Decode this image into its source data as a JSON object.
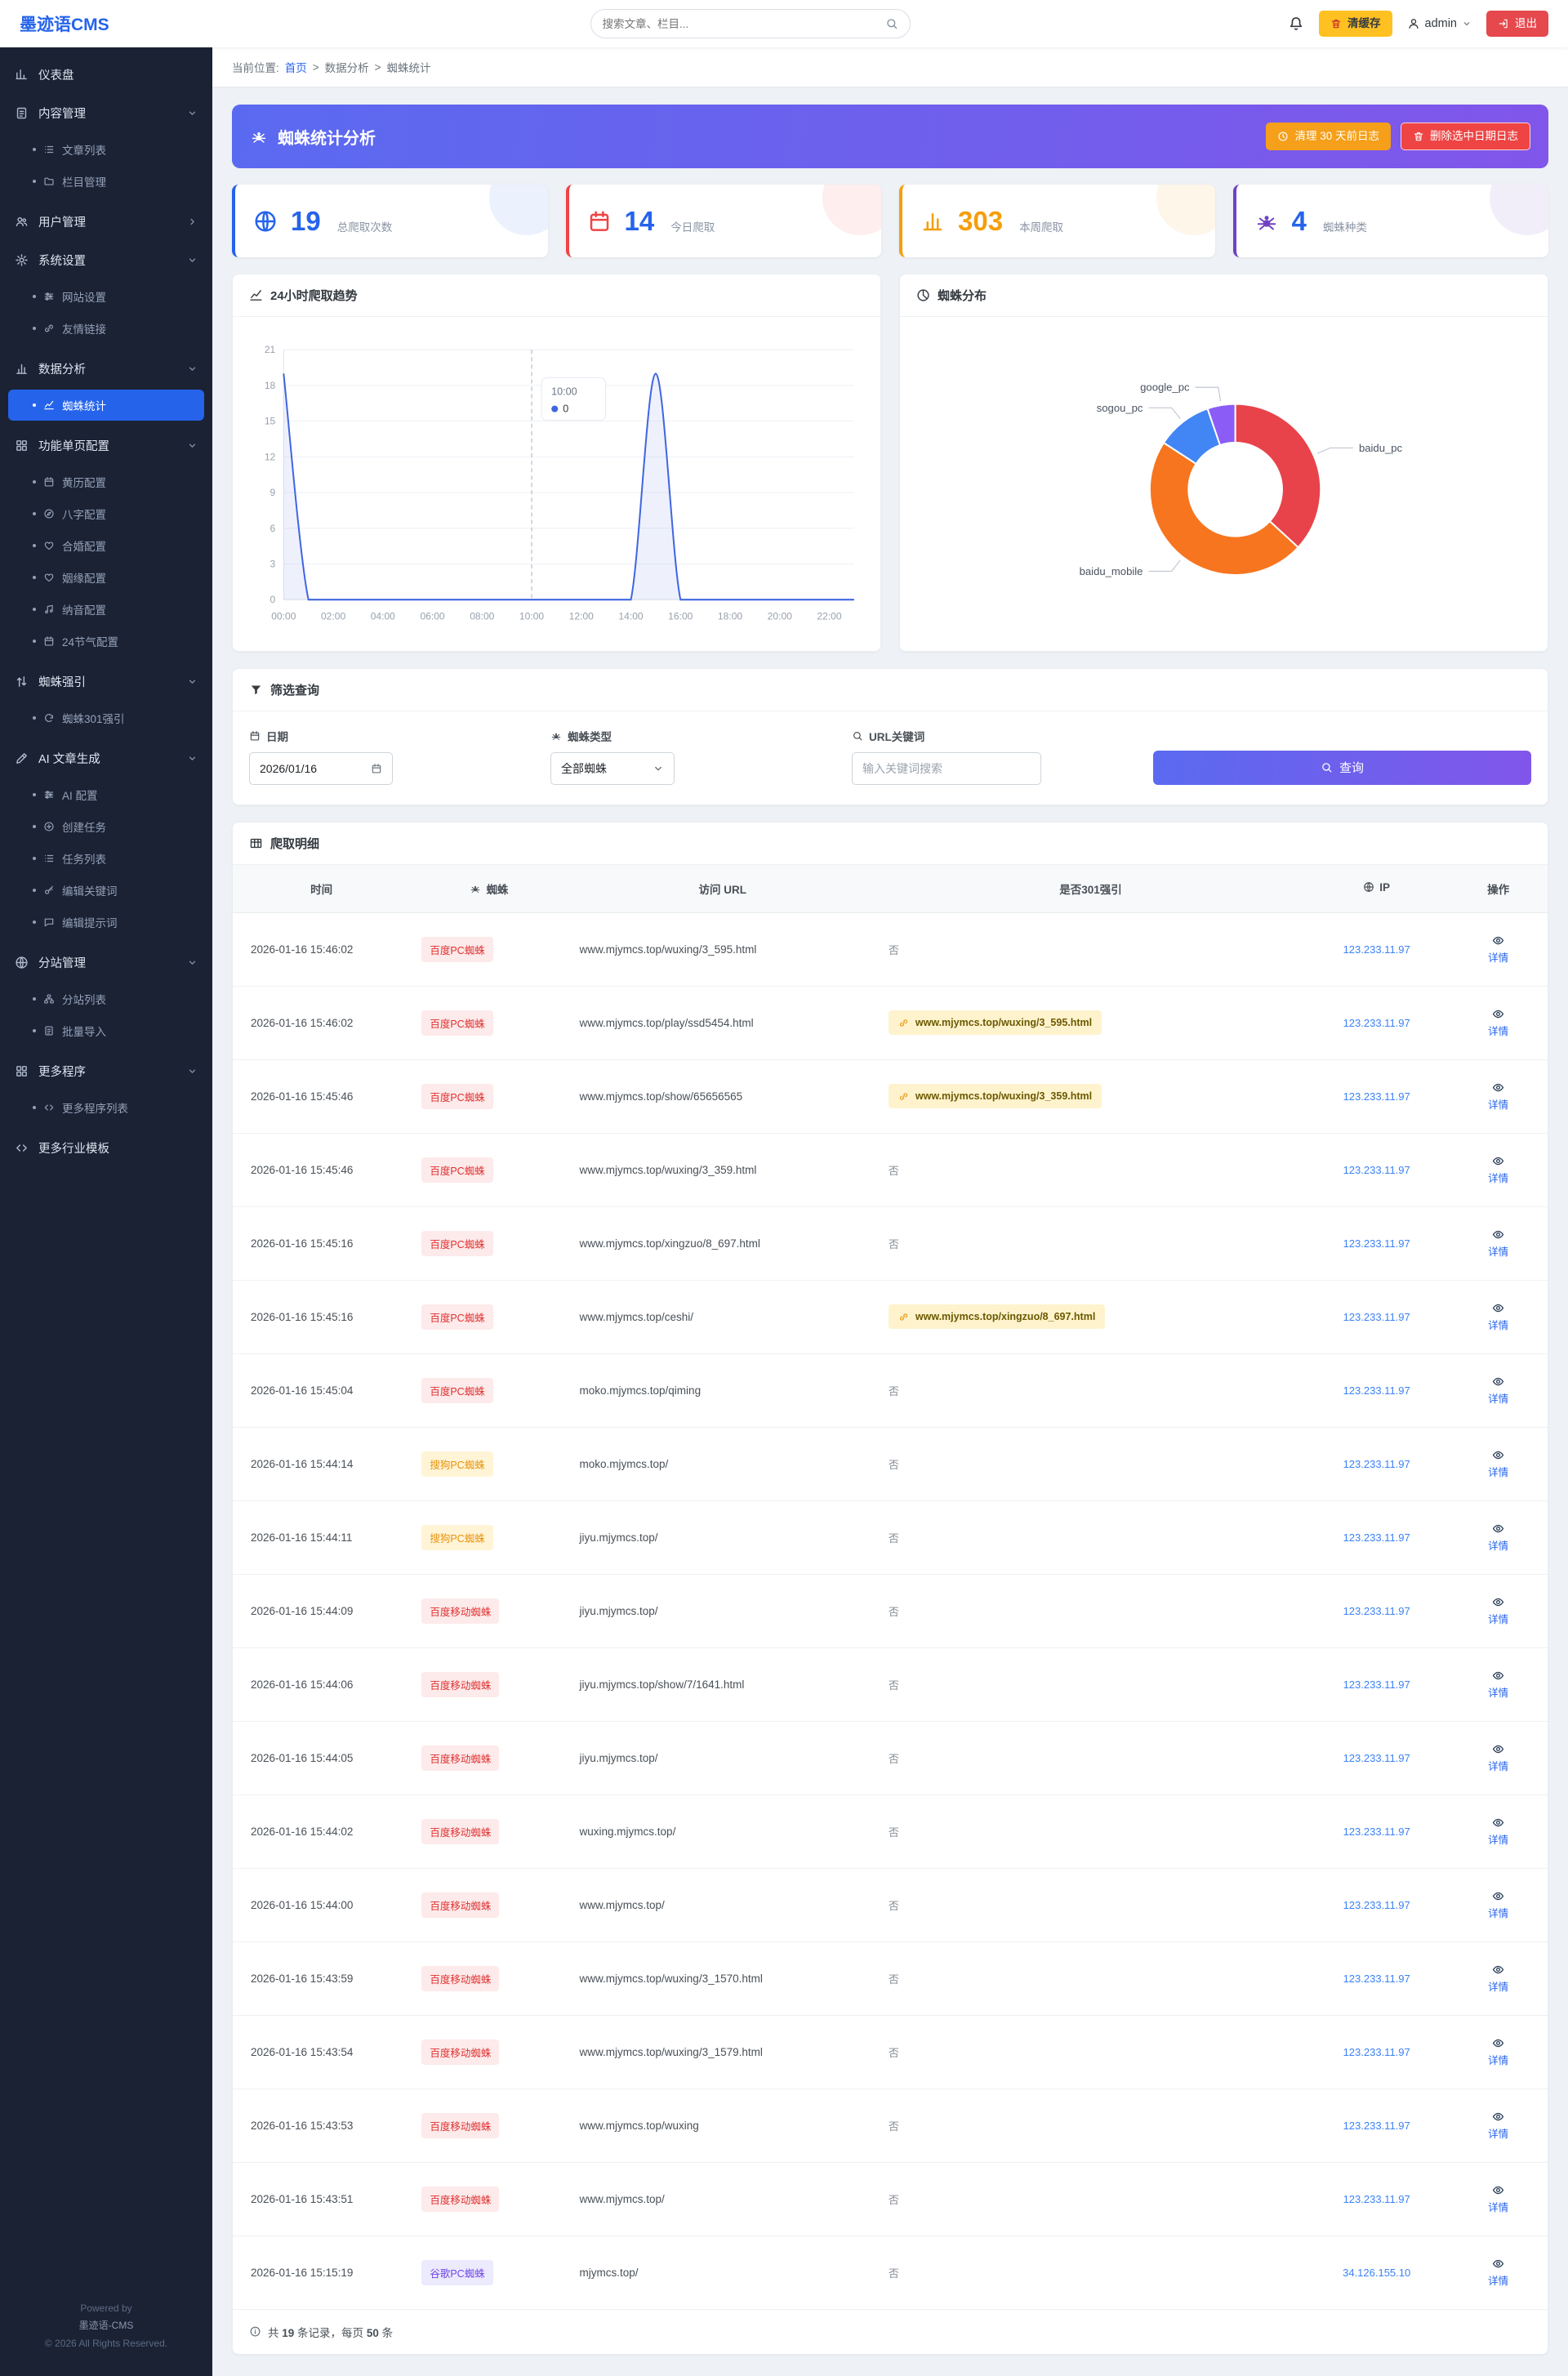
{
  "topbar": {
    "logo": "墨迹语CMS",
    "search_placeholder": "搜索文章、栏目...",
    "clear_cache_label": "清缓存",
    "username": "admin",
    "logout_label": "退出"
  },
  "breadcrumb": {
    "prefix": "当前位置:",
    "home": "首页",
    "sep": ">",
    "section": "数据分析",
    "current": "蜘蛛统计"
  },
  "page_header": {
    "title": "蜘蛛统计分析",
    "btn_clean": "清理 30 天前日志",
    "btn_delete": "删除选中日期日志"
  },
  "stats": {
    "cards": [
      {
        "value": "19",
        "label": "总爬取次数",
        "accent": "#2563eb",
        "number_color": "#2563eb",
        "icon": "globe"
      },
      {
        "value": "14",
        "label": "今日爬取",
        "accent": "#ef4444",
        "number_color": "#2563eb",
        "icon": "calendar"
      },
      {
        "value": "303",
        "label": "本周爬取",
        "accent": "#f59e0b",
        "number_color": "#f59e0b",
        "icon": "chart"
      },
      {
        "value": "4",
        "label": "蜘蛛种类",
        "accent": "#6f42c1",
        "number_color": "#2563eb",
        "icon": "spider"
      }
    ]
  },
  "chart_data": [
    {
      "type": "line",
      "title": "24小时爬取趋势",
      "x": [
        "00:00",
        "01:00",
        "02:00",
        "03:00",
        "04:00",
        "05:00",
        "06:00",
        "07:00",
        "08:00",
        "09:00",
        "10:00",
        "11:00",
        "12:00",
        "13:00",
        "14:00",
        "15:00",
        "16:00",
        "17:00",
        "18:00",
        "19:00",
        "20:00",
        "21:00",
        "22:00",
        "23:00"
      ],
      "values": [
        19,
        0,
        0,
        0,
        0,
        0,
        0,
        0,
        0,
        0,
        0,
        0,
        0,
        0,
        0,
        19,
        0,
        0,
        0,
        0,
        0,
        0,
        0,
        0
      ],
      "ylim": [
        0,
        21
      ],
      "yticks": [
        0,
        3,
        6,
        9,
        12,
        15,
        18,
        21
      ],
      "line_color": "#4066e0",
      "grid": true,
      "legend": false,
      "tooltip": {
        "x": "10:00",
        "value": 0
      }
    },
    {
      "type": "pie",
      "title": "蜘蛛分布",
      "labels": [
        "baidu_pc",
        "baidu_mobile",
        "sogou_pc",
        "google_pc"
      ],
      "values": [
        7,
        9,
        2,
        1
      ],
      "colors": [
        "#e8434a",
        "#f7751f",
        "#4285f4",
        "#8b5cf6"
      ],
      "donut": true,
      "legend_position": "outside-labels"
    }
  ],
  "filter": {
    "title": "筛选查询",
    "date_label": "日期",
    "date_value": "2026/01/16",
    "type_label": "蜘蛛类型",
    "type_value": "全部蜘蛛",
    "keyword_label": "URL关键词",
    "keyword_placeholder": "输入关键词搜索",
    "search_label": "查询"
  },
  "table": {
    "title": "爬取明细",
    "columns": [
      {
        "key": "time",
        "label": "时间"
      },
      {
        "key": "spider",
        "label": "蜘蛛",
        "icon": "spider"
      },
      {
        "key": "url",
        "label": "访问 URL"
      },
      {
        "key": "redirect",
        "label": "是否301强引"
      },
      {
        "key": "ip",
        "label": "IP",
        "icon": "globe"
      },
      {
        "key": "action",
        "label": "操作"
      }
    ],
    "no_redirect_text": "否",
    "action_label": "详情",
    "rows": [
      {
        "time": "2026-01-16 15:46:02",
        "spider": "百度PC蜘蛛",
        "spider_type": "baidu_pc",
        "url": "www.mjymcs.top/wuxing/3_595.html",
        "redirect": "",
        "ip": "123.233.11.97"
      },
      {
        "time": "2026-01-16 15:46:02",
        "spider": "百度PC蜘蛛",
        "spider_type": "baidu_pc",
        "url": "www.mjymcs.top/play/ssd5454.html",
        "redirect": "www.mjymcs.top/wuxing/3_595.html",
        "ip": "123.233.11.97"
      },
      {
        "time": "2026-01-16 15:45:46",
        "spider": "百度PC蜘蛛",
        "spider_type": "baidu_pc",
        "url": "www.mjymcs.top/show/65656565",
        "redirect": "www.mjymcs.top/wuxing/3_359.html",
        "ip": "123.233.11.97"
      },
      {
        "time": "2026-01-16 15:45:46",
        "spider": "百度PC蜘蛛",
        "spider_type": "baidu_pc",
        "url": "www.mjymcs.top/wuxing/3_359.html",
        "redirect": "",
        "ip": "123.233.11.97"
      },
      {
        "time": "2026-01-16 15:45:16",
        "spider": "百度PC蜘蛛",
        "spider_type": "baidu_pc",
        "url": "www.mjymcs.top/xingzuo/8_697.html",
        "redirect": "",
        "ip": "123.233.11.97"
      },
      {
        "time": "2026-01-16 15:45:16",
        "spider": "百度PC蜘蛛",
        "spider_type": "baidu_pc",
        "url": "www.mjymcs.top/ceshi/",
        "redirect": "www.mjymcs.top/xingzuo/8_697.html",
        "ip": "123.233.11.97"
      },
      {
        "time": "2026-01-16 15:45:04",
        "spider": "百度PC蜘蛛",
        "spider_type": "baidu_pc",
        "url": "moko.mjymcs.top/qiming",
        "redirect": "",
        "ip": "123.233.11.97"
      },
      {
        "time": "2026-01-16 15:44:14",
        "spider": "搜狗PC蜘蛛",
        "spider_type": "sogou_pc",
        "url": "moko.mjymcs.top/",
        "redirect": "",
        "ip": "123.233.11.97"
      },
      {
        "time": "2026-01-16 15:44:11",
        "spider": "搜狗PC蜘蛛",
        "spider_type": "sogou_pc",
        "url": "jiyu.mjymcs.top/",
        "redirect": "",
        "ip": "123.233.11.97"
      },
      {
        "time": "2026-01-16 15:44:09",
        "spider": "百度移动蜘蛛",
        "spider_type": "baidu_mobile",
        "url": "jiyu.mjymcs.top/",
        "redirect": "",
        "ip": "123.233.11.97"
      },
      {
        "time": "2026-01-16 15:44:06",
        "spider": "百度移动蜘蛛",
        "spider_type": "baidu_mobile",
        "url": "jiyu.mjymcs.top/show/7/1641.html",
        "redirect": "",
        "ip": "123.233.11.97"
      },
      {
        "time": "2026-01-16 15:44:05",
        "spider": "百度移动蜘蛛",
        "spider_type": "baidu_mobile",
        "url": "jiyu.mjymcs.top/",
        "redirect": "",
        "ip": "123.233.11.97"
      },
      {
        "time": "2026-01-16 15:44:02",
        "spider": "百度移动蜘蛛",
        "spider_type": "baidu_mobile",
        "url": "wuxing.mjymcs.top/",
        "redirect": "",
        "ip": "123.233.11.97"
      },
      {
        "time": "2026-01-16 15:44:00",
        "spider": "百度移动蜘蛛",
        "spider_type": "baidu_mobile",
        "url": "www.mjymcs.top/",
        "redirect": "",
        "ip": "123.233.11.97"
      },
      {
        "time": "2026-01-16 15:43:59",
        "spider": "百度移动蜘蛛",
        "spider_type": "baidu_mobile",
        "url": "www.mjymcs.top/wuxing/3_1570.html",
        "redirect": "",
        "ip": "123.233.11.97"
      },
      {
        "time": "2026-01-16 15:43:54",
        "spider": "百度移动蜘蛛",
        "spider_type": "baidu_mobile",
        "url": "www.mjymcs.top/wuxing/3_1579.html",
        "redirect": "",
        "ip": "123.233.11.97"
      },
      {
        "time": "2026-01-16 15:43:53",
        "spider": "百度移动蜘蛛",
        "spider_type": "baidu_mobile",
        "url": "www.mjymcs.top/wuxing",
        "redirect": "",
        "ip": "123.233.11.97"
      },
      {
        "time": "2026-01-16 15:43:51",
        "spider": "百度移动蜘蛛",
        "spider_type": "baidu_mobile",
        "url": "www.mjymcs.top/",
        "redirect": "",
        "ip": "123.233.11.97"
      },
      {
        "time": "2026-01-16 15:15:19",
        "spider": "谷歌PC蜘蛛",
        "spider_type": "google_pc",
        "url": "mjymcs.top/",
        "redirect": "",
        "ip": "34.126.155.10"
      }
    ],
    "footer": {
      "prefix": "共",
      "count": "19",
      "middle": "条记录，每页",
      "per_page": "50",
      "suffix": "条"
    }
  },
  "sidebar": {
    "items": [
      {
        "key": "dashboard",
        "icon": "dashboard",
        "label": "仪表盘",
        "type": "link"
      },
      {
        "key": "content",
        "icon": "doc",
        "label": "内容管理",
        "type": "group",
        "expanded": true,
        "children": [
          {
            "key": "article-list",
            "icon": "list",
            "label": "文章列表"
          },
          {
            "key": "category-manage",
            "icon": "folder",
            "label": "栏目管理"
          }
        ]
      },
      {
        "key": "users",
        "icon": "users",
        "label": "用户管理",
        "type": "group",
        "expanded": false,
        "children": []
      },
      {
        "key": "system",
        "icon": "gear",
        "label": "系统设置",
        "type": "group",
        "expanded": true,
        "children": [
          {
            "key": "site-settings",
            "icon": "sliders",
            "label": "网站设置"
          },
          {
            "key": "friend-links",
            "icon": "link",
            "label": "友情链接"
          }
        ]
      },
      {
        "key": "analytics",
        "icon": "chart",
        "label": "数据分析",
        "type": "group",
        "expanded": true,
        "children": [
          {
            "key": "spider-stats",
            "icon": "trend",
            "label": "蜘蛛统计",
            "active": true
          }
        ]
      },
      {
        "key": "pages",
        "icon": "apps",
        "label": "功能单页配置",
        "type": "group",
        "expanded": true,
        "children": [
          {
            "key": "huangli-config",
            "icon": "calendar",
            "label": "黄历配置"
          },
          {
            "key": "bazi-config",
            "icon": "compass",
            "label": "八字配置"
          },
          {
            "key": "hehun-config",
            "icon": "heart",
            "label": "合婚配置"
          },
          {
            "key": "yinyuan-config",
            "icon": "heart",
            "label": "姻缘配置"
          },
          {
            "key": "nayin-config",
            "icon": "music",
            "label": "纳音配置"
          },
          {
            "key": "jieqi-config",
            "icon": "calendar",
            "label": "24节气配置"
          }
        ]
      },
      {
        "key": "spider-pull",
        "icon": "swap",
        "label": "蜘蛛强引",
        "type": "group",
        "expanded": true,
        "children": [
          {
            "key": "spider-301",
            "icon": "refresh",
            "label": "蜘蛛301强引"
          }
        ]
      },
      {
        "key": "ai",
        "icon": "pen",
        "label": "AI 文章生成",
        "type": "group",
        "expanded": true,
        "children": [
          {
            "key": "ai-config",
            "icon": "sliders",
            "label": "AI 配置"
          },
          {
            "key": "create-task",
            "icon": "plus",
            "label": "创建任务"
          },
          {
            "key": "task-list",
            "icon": "list",
            "label": "任务列表"
          },
          {
            "key": "edit-keywords",
            "icon": "key",
            "label": "编辑关键词"
          },
          {
            "key": "edit-prompts",
            "icon": "chat",
            "label": "编辑提示词"
          }
        ]
      },
      {
        "key": "subsites",
        "icon": "globe",
        "label": "分站管理",
        "type": "group",
        "expanded": true,
        "children": [
          {
            "key": "subsite-list",
            "icon": "sitemap",
            "label": "分站列表"
          },
          {
            "key": "batch-import",
            "icon": "doc",
            "label": "批量导入"
          }
        ]
      },
      {
        "key": "more-apps",
        "icon": "apps",
        "label": "更多程序",
        "type": "group",
        "expanded": true,
        "children": [
          {
            "key": "more-program-list",
            "icon": "code",
            "label": "更多程序列表"
          }
        ]
      },
      {
        "key": "templates",
        "icon": "code",
        "label": "更多行业模板",
        "type": "link"
      }
    ],
    "footer": {
      "line1": "Powered by",
      "line2": "墨迹语-CMS",
      "line3": "© 2026 All Rights Reserved."
    }
  }
}
